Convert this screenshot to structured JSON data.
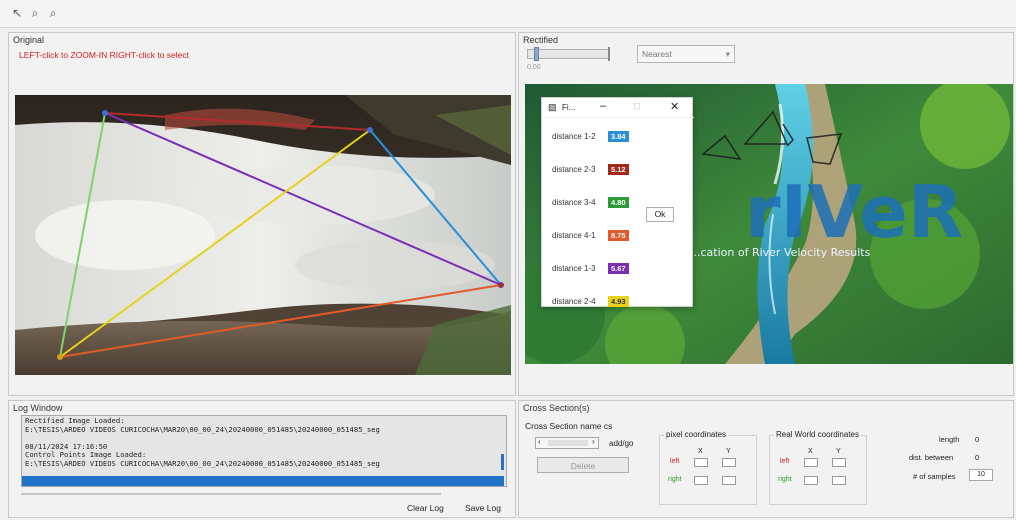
{
  "toolbar": {
    "icons": [
      "pointer-icon",
      "zoom-in-icon",
      "zoom-out-icon"
    ]
  },
  "original": {
    "title": "Original",
    "hint": "LEFT-click to ZOOM-IN RIGHT-click to select"
  },
  "rectified": {
    "title": "Rectified",
    "slider_value": "0.00",
    "dropdown": "Nearest",
    "splash_text": "rIVeR",
    "splash_subtitle": "...cation of River Velocity Results"
  },
  "popup": {
    "title": "Fi...",
    "ok_label": "Ok",
    "rows": [
      {
        "label": "distance 1-2",
        "value": "3.84",
        "color": "#2b8fd8"
      },
      {
        "label": "distance 2-3",
        "value": "5.12",
        "color": "#a3271a"
      },
      {
        "label": "distance 3-4",
        "value": "4.80",
        "color": "#2e9b3a"
      },
      {
        "label": "distance 4-1",
        "value": "8.75",
        "color": "#e05a2a"
      },
      {
        "label": "distance 1-3",
        "value": "5.67",
        "color": "#7a2eb5"
      },
      {
        "label": "distance 2-4",
        "value": "4.93",
        "color": "#e6d21a"
      }
    ]
  },
  "log": {
    "title": "Log Window",
    "lines": [
      "Rectified Image Loaded:",
      "E:\\TESIS\\ARDEO VIDEOS CURICOCHA\\MAR20\\00_00_24\\20240000_051485\\20240000_051485_seg",
      "",
      "08/11/2024 17:16:50",
      "Control Points Image Loaded:",
      "E:\\TESIS\\ARDEO VIDEOS CURICOCHA\\MAR20\\00_00_24\\20240000_051485\\20240000_051485_seg",
      ""
    ],
    "clear_label": "Clear Log",
    "save_label": "Save Log"
  },
  "cross": {
    "title": "Cross Section(s)",
    "name_label": "Cross Section name cs",
    "add_label": "add/go",
    "delete_label": "Delete",
    "pixel_title": "pixel coordinates",
    "real_title": "Real World coordinates",
    "x_label": "X",
    "y_label": "Y",
    "left_label": "left",
    "right_label": "right",
    "length_label": "length",
    "length_value": "0",
    "dist_label": "dist. between",
    "dist_value": "0",
    "samples_label": "# of samples",
    "samples_value": "10"
  }
}
